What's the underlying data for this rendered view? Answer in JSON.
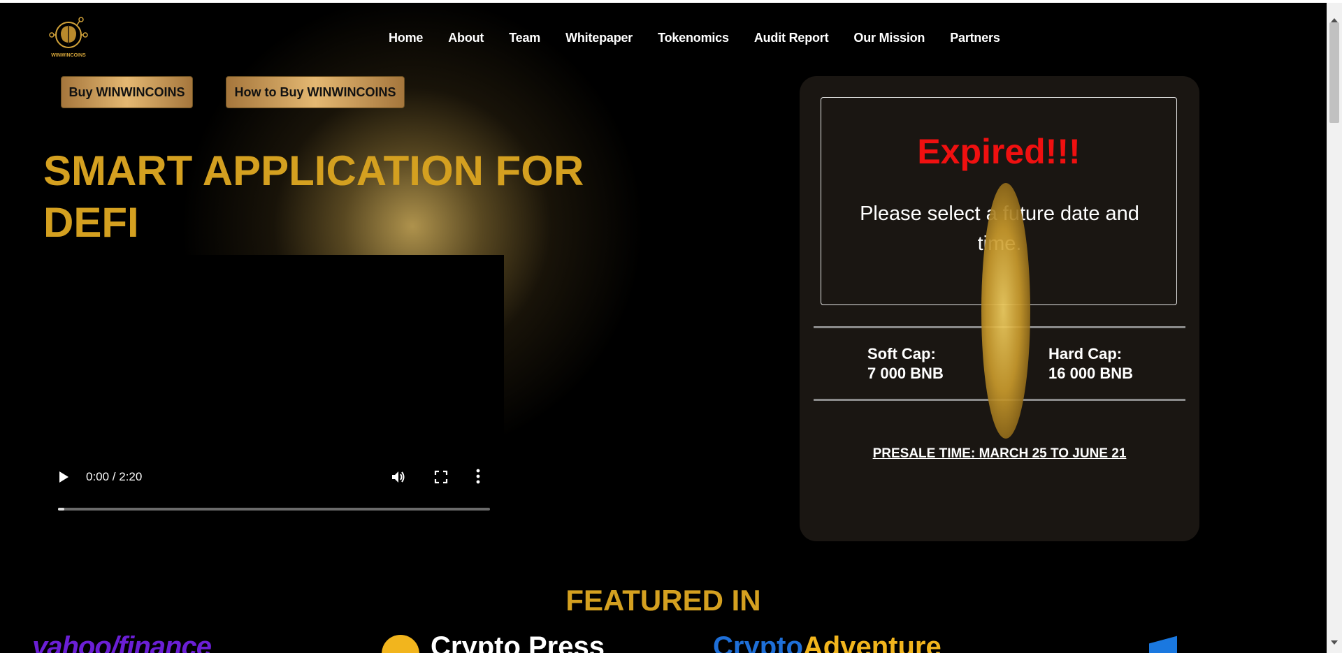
{
  "logo": {
    "text": "WINWINCOINS",
    "icon": "brain-circuit-logo"
  },
  "nav": [
    "Home",
    "About",
    "Team",
    "Whitepaper",
    "Tokenomics",
    "Audit Report",
    "Our Mission",
    "Partners"
  ],
  "buttons": {
    "buy": "Buy WINWINCOINS",
    "how": "How to Buy WINWINCOINS"
  },
  "hero": {
    "title": "SMART APPLICATION FOR DEFI"
  },
  "video": {
    "time": "0:00 / 2:20",
    "progress": 0.0
  },
  "countdown": {
    "status": "Expired!!!",
    "message": "Please select a future date and time.",
    "soft_cap_label": "Soft Cap:",
    "soft_cap_value": "7 000 BNB",
    "hard_cap_label": "Hard Cap:",
    "hard_cap_value": "16 000 BNB",
    "presale": "PRESALE TIME: MARCH 25 TO JUNE 21"
  },
  "featured": {
    "title": "FEATURED IN",
    "logos": [
      "yahoo/finance",
      "Crypto Press",
      "Crypto",
      "Adventure"
    ]
  },
  "colors": {
    "gold": "#d4a020",
    "expired": "#f01010",
    "card": "#1a1612"
  }
}
